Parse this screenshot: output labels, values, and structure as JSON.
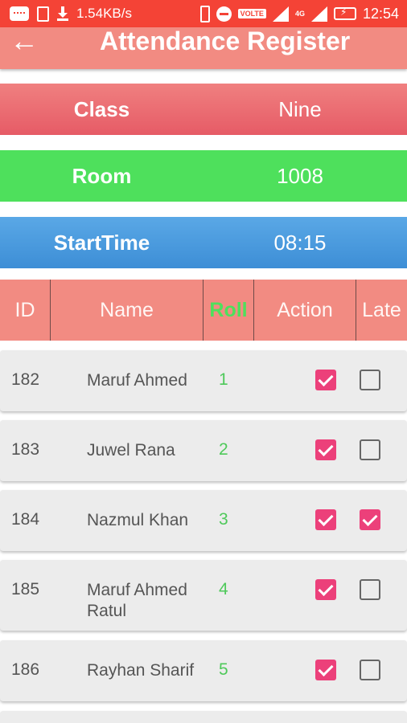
{
  "status_bar": {
    "speed": "1.54KB/s",
    "volte": "VOLTE",
    "net_a": "4G",
    "time": "12:54"
  },
  "toolbar": {
    "back_icon": "arrow-left-icon",
    "title": "Attendance Register"
  },
  "info": {
    "class_label": "Class",
    "class_value": "Nine",
    "room_label": "Room",
    "room_value": "1008",
    "start_label": "StartTime",
    "start_value": "08:15"
  },
  "table": {
    "headers": [
      "ID",
      "Name",
      "Roll",
      "Action",
      "Late"
    ],
    "rows": [
      {
        "id": "182",
        "name": "Maruf Ahmed",
        "roll": "1",
        "action": true,
        "late": false
      },
      {
        "id": "183",
        "name": "Juwel Rana",
        "roll": "2",
        "action": true,
        "late": false
      },
      {
        "id": "184",
        "name": "Nazmul Khan",
        "roll": "3",
        "action": true,
        "late": true
      },
      {
        "id": "185",
        "name": "Maruf Ahmed Ratul",
        "roll": "4",
        "action": true,
        "late": false
      },
      {
        "id": "186",
        "name": "Rayhan Sharif",
        "roll": "5",
        "action": true,
        "late": false
      }
    ]
  },
  "colors": {
    "status_bar": "#f44336",
    "toolbar": "#f28b82",
    "room_bar": "#4ee05c",
    "checkbox_on": "#ec407a"
  }
}
